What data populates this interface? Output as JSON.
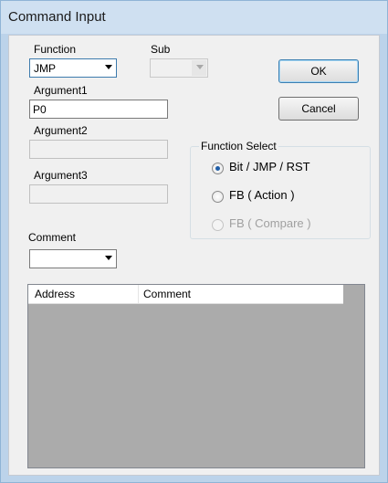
{
  "window": {
    "title": "Command Input"
  },
  "function": {
    "label": "Function",
    "value": "JMP"
  },
  "sub": {
    "label": "Sub",
    "value": ""
  },
  "argument1": {
    "label": "Argument1",
    "value": "P0"
  },
  "argument2": {
    "label": "Argument2",
    "value": ""
  },
  "argument3": {
    "label": "Argument3",
    "value": ""
  },
  "comment": {
    "label": "Comment",
    "value": ""
  },
  "buttons": {
    "ok": "OK",
    "cancel": "Cancel"
  },
  "function_select": {
    "title": "Function Select",
    "options": [
      {
        "label": "Bit / JMP / RST",
        "checked": true,
        "enabled": true
      },
      {
        "label": "FB ( Action )",
        "checked": false,
        "enabled": true
      },
      {
        "label": "FB ( Compare )",
        "checked": false,
        "enabled": false
      }
    ]
  },
  "list": {
    "columns": [
      "Address",
      "Comment"
    ]
  }
}
